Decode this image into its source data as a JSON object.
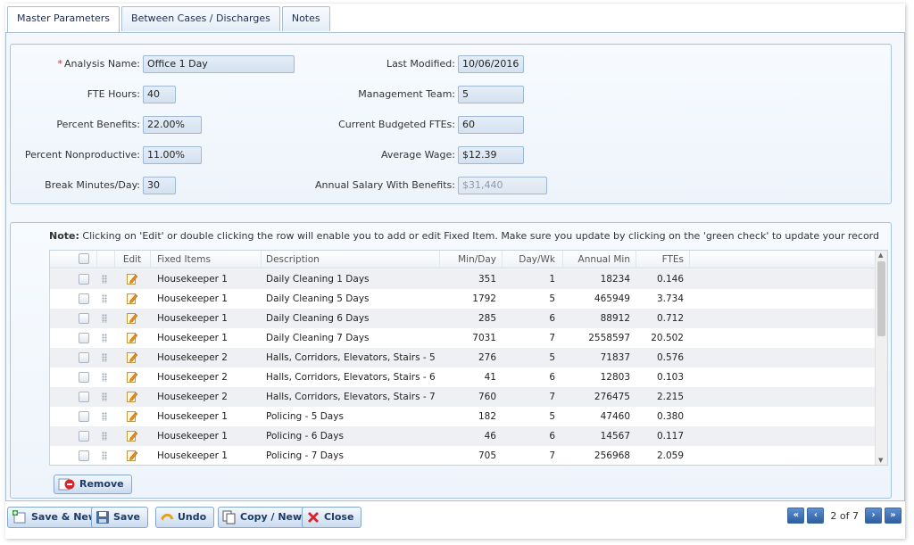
{
  "tabs": [
    {
      "label": "Master Parameters",
      "active": true
    },
    {
      "label": "Between Cases / Discharges",
      "active": false
    },
    {
      "label": "Notes",
      "active": false
    }
  ],
  "master": {
    "left": [
      {
        "label": "Analysis Name:",
        "value": "Office 1 Day",
        "required": true
      },
      {
        "label": "FTE Hours:",
        "value": "40"
      },
      {
        "label": "Percent Benefits:",
        "value": "22.00%"
      },
      {
        "label": "Percent Nonproductive:",
        "value": "11.00%"
      },
      {
        "label": "Break Minutes/Day:",
        "value": "30"
      }
    ],
    "right": [
      {
        "label": "Last Modified:",
        "value": "10/06/2016"
      },
      {
        "label": "Management Team:",
        "value": "5"
      },
      {
        "label": "Current Budgeted FTEs:",
        "value": "60"
      },
      {
        "label": "Average Wage:",
        "value": "$12.39"
      },
      {
        "label": "Annual Salary With Benefits:",
        "value": "$31,440"
      }
    ]
  },
  "note": {
    "prefix": "Note:",
    "text": " Clicking on 'Edit' or double clicking the row will enable you to add or edit Fixed Item. Make sure you update by clicking on the 'green check' to update your record"
  },
  "grid": {
    "headers": {
      "edit": "Edit",
      "fixed_items": "Fixed Items",
      "description": "Description",
      "min_day": "Min/Day",
      "day_wk": "Day/Wk",
      "annual_min": "Annual Min",
      "ftes": "FTEs"
    },
    "rows": [
      {
        "item": "Housekeeper 1",
        "desc": "Daily Cleaning 1 Days",
        "min": "351",
        "days": "1",
        "annual": "18234",
        "ftes": "0.146"
      },
      {
        "item": "Housekeeper 1",
        "desc": "Daily Cleaning 5 Days",
        "min": "1792",
        "days": "5",
        "annual": "465949",
        "ftes": "3.734"
      },
      {
        "item": "Housekeeper 1",
        "desc": "Daily Cleaning 6 Days",
        "min": "285",
        "days": "6",
        "annual": "88912",
        "ftes": "0.712"
      },
      {
        "item": "Housekeeper 1",
        "desc": "Daily Cleaning 7 Days",
        "min": "7031",
        "days": "7",
        "annual": "2558597",
        "ftes": "20.502"
      },
      {
        "item": "Housekeeper 2",
        "desc": "Halls, Corridors, Elevators, Stairs - 5 Days",
        "min": "276",
        "days": "5",
        "annual": "71837",
        "ftes": "0.576"
      },
      {
        "item": "Housekeeper 2",
        "desc": "Halls, Corridors, Elevators, Stairs - 6 Days",
        "min": "41",
        "days": "6",
        "annual": "12803",
        "ftes": "0.103"
      },
      {
        "item": "Housekeeper 2",
        "desc": "Halls, Corridors, Elevators, Stairs - 7 Days",
        "min": "760",
        "days": "7",
        "annual": "276475",
        "ftes": "2.215"
      },
      {
        "item": "Housekeeper 1",
        "desc": "Policing - 5 Days",
        "min": "182",
        "days": "5",
        "annual": "47460",
        "ftes": "0.380"
      },
      {
        "item": "Housekeeper 1",
        "desc": "Policing - 6 Days",
        "min": "46",
        "days": "6",
        "annual": "14567",
        "ftes": "0.117"
      },
      {
        "item": "Housekeeper 1",
        "desc": "Policing - 7 Days",
        "min": "705",
        "days": "7",
        "annual": "256968",
        "ftes": "2.059"
      }
    ]
  },
  "buttons": {
    "remove": "Remove",
    "save_new": "Save & New",
    "save": "Save",
    "undo": "Undo",
    "copy_new": "Copy / New",
    "close": "Close"
  },
  "pager": {
    "info": "2 of 7"
  },
  "icons": {
    "save_new": "save-new-icon",
    "save": "floppy-disk-icon",
    "undo": "undo-arrow-icon",
    "copy": "copy-documents-icon",
    "close": "red-x-icon",
    "remove": "minus-circle-icon",
    "edit": "edit-pencil-icon"
  },
  "colors": {
    "accent": "#2f5f9f",
    "required": "#dd2222",
    "close_x": "#d8252a",
    "remove_icon": "#d8252a"
  }
}
